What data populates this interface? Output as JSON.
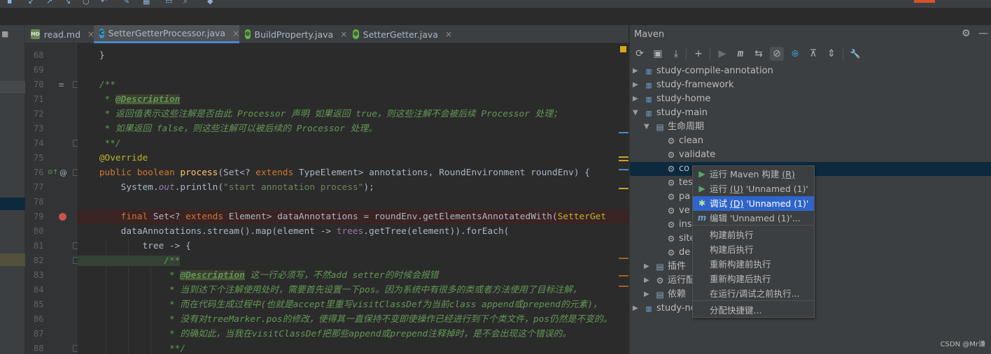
{
  "tabs": [
    {
      "label": "read.md",
      "icon": "markdown-icon",
      "close": "×"
    },
    {
      "label": "SetterGetterProcessor.java",
      "icon": "java-class-icon",
      "close": "×"
    },
    {
      "label": "BuildProperty.java",
      "icon": "java-file-icon",
      "close": "×"
    },
    {
      "label": "SetterGetter.java",
      "icon": "java-file-icon",
      "close": "×"
    }
  ],
  "editor": {
    "line_numbers": [
      "68",
      "69",
      "70",
      "71",
      "72",
      "73",
      "74",
      "75",
      "76",
      "77",
      "78",
      "79",
      "80",
      "81",
      "82",
      "83",
      "84",
      "85",
      "86",
      "87",
      "88"
    ],
    "lines": [
      [
        {
          "t": "    }",
          "c": ""
        }
      ],
      [],
      [
        {
          "t": "    /**",
          "c": "cm"
        }
      ],
      [
        {
          "t": "     * ",
          "c": "cm"
        },
        {
          "t": "@Description",
          "c": "tag"
        }
      ],
      [
        {
          "t": "     * 返回值表示这些注解是否由此 Processor 声明 如果返回 true，则这些注解不会被后续 Processor 处理；",
          "c": "cm"
        }
      ],
      [
        {
          "t": "     * 如果返回 false，则这些注解可以被后续的 Processor 处理。",
          "c": "cm"
        }
      ],
      [
        {
          "t": "     **/",
          "c": "cm"
        }
      ],
      [
        {
          "t": "    @Override",
          "c": "ann"
        }
      ],
      [
        {
          "t": "    public boolean ",
          "c": "kw"
        },
        {
          "t": "process",
          "c": "fn"
        },
        {
          "t": "(Set<? ",
          "c": ""
        },
        {
          "t": "extends ",
          "c": "kw"
        },
        {
          "t": "TypeElement> annotations, RoundEnvironment roundEnv) {",
          "c": ""
        }
      ],
      [
        {
          "t": "        System.",
          "c": ""
        },
        {
          "t": "out",
          "c": "sttc"
        },
        {
          "t": ".println(",
          "c": ""
        },
        {
          "t": "\"start annotation process\"",
          "c": "str"
        },
        {
          "t": ");",
          "c": ""
        }
      ],
      [],
      [
        {
          "t": "        final ",
          "c": "kw"
        },
        {
          "t": "Set<? ",
          "c": ""
        },
        {
          "t": "extends ",
          "c": "kw"
        },
        {
          "t": "Element> dataAnnotations = roundEnv.getElementsAnnotatedWith(",
          "c": ""
        },
        {
          "t": "SetterGet",
          "c": "ann"
        }
      ],
      [
        {
          "t": "        dataAnnotations.stream().map(element -> ",
          "c": ""
        },
        {
          "t": "trees",
          "c": "fld"
        },
        {
          "t": ".getTree(element)).forEach(",
          "c": ""
        }
      ],
      [
        {
          "t": "            tree -> {",
          "c": ""
        }
      ],
      [
        {
          "t": "                /**",
          "c": "cm"
        }
      ],
      [
        {
          "t": "                 * ",
          "c": "cm"
        },
        {
          "t": "@Description",
          "c": "tag"
        },
        {
          "t": " 这一行必须写，不然add setter的时候会报错",
          "c": "cm"
        }
      ],
      [
        {
          "t": "                 * 当到达下个注解使用处时，需要首先设置一下pos。因为系统中有很多的类或者方法使用了目标注解，",
          "c": "cm"
        }
      ],
      [
        {
          "t": "                 * 而在代码生成过程中(也就是accept里重写visitClassDef为当前class append或prepend的元素)，",
          "c": "cm"
        }
      ],
      [
        {
          "t": "                 * 没有对treeMarker.pos的修改，使得其一直保持不变即使操作已经进行到下个类文件，pos仍然是不变的。",
          "c": "cm"
        }
      ],
      [
        {
          "t": "                 * 的确如此，当我在visitClassDef把那些append或prepend注释掉时，是不会出现这个错误的。",
          "c": "cm"
        }
      ],
      [
        {
          "t": "                 **/",
          "c": "cm"
        }
      ]
    ]
  },
  "maven": {
    "title": "Maven",
    "toolbar": [
      "reload-icon",
      "add-folder-icon",
      "download-icon",
      "plus-icon",
      "run-icon",
      "maven-goal-icon",
      "toggle-offline-icon",
      "skip-tests-icon",
      "show-dependencies-icon",
      "collapse-icon",
      "expand-icon",
      "settings-wrench-icon"
    ],
    "tree": [
      {
        "label": "study-compile-annotation",
        "level": 0,
        "arrow": "▶",
        "icon": "m"
      },
      {
        "label": "study-framework",
        "level": 0,
        "arrow": "▶",
        "icon": "m"
      },
      {
        "label": "study-home",
        "level": 0,
        "arrow": "▶",
        "icon": "m"
      },
      {
        "label": "study-main",
        "level": 0,
        "arrow": "▼",
        "icon": "m"
      },
      {
        "label": "生命周期",
        "level": 1,
        "arrow": "▼",
        "icon": "folder"
      },
      {
        "label": "clean",
        "level": 2,
        "arrow": "",
        "icon": "gear"
      },
      {
        "label": "validate",
        "level": 2,
        "arrow": "",
        "icon": "gear"
      },
      {
        "label": "co",
        "level": 2,
        "arrow": "",
        "icon": "gear"
      },
      {
        "label": "tes",
        "level": 2,
        "arrow": "",
        "icon": "gear"
      },
      {
        "label": "pa",
        "level": 2,
        "arrow": "",
        "icon": "gear"
      },
      {
        "label": "ve",
        "level": 2,
        "arrow": "",
        "icon": "gear"
      },
      {
        "label": "ins",
        "level": 2,
        "arrow": "",
        "icon": "gear"
      },
      {
        "label": "site",
        "level": 2,
        "arrow": "",
        "icon": "gear"
      },
      {
        "label": "de",
        "level": 2,
        "arrow": "",
        "icon": "gear"
      },
      {
        "label": "插件",
        "level": 1,
        "arrow": "▶",
        "icon": "folder"
      },
      {
        "label": "运行配",
        "level": 1,
        "arrow": "▶",
        "icon": "gear"
      },
      {
        "label": "依赖",
        "level": 1,
        "arrow": "▶",
        "icon": "folder"
      },
      {
        "label": "study-no",
        "level": 0,
        "arrow": "▶",
        "icon": "m"
      }
    ]
  },
  "context_menu": {
    "items": [
      {
        "label": "运行 Maven 构建 ",
        "mnemonic": "(R)",
        "icon": "▶",
        "icon_name": "run-icon",
        "highlighted": false
      },
      {
        "label": "运行 ",
        "mnemonic": "(U)",
        "suffix": " 'Unnamed (1)'",
        "icon": "▶",
        "icon_name": "run-icon",
        "highlighted": false
      },
      {
        "label": "调试 ",
        "mnemonic": "(D)",
        "suffix": " 'Unnamed (1)'",
        "icon": "✱",
        "icon_name": "debug-icon",
        "highlighted": true
      },
      {
        "label": "编辑 'Unnamed (1)'...",
        "mnemonic": "",
        "icon": "m",
        "icon_name": "maven-icon",
        "highlighted": false
      },
      {
        "label": "构建前执行",
        "mnemonic": "",
        "icon": "",
        "highlighted": false
      },
      {
        "label": "构建后执行",
        "mnemonic": "",
        "icon": "",
        "highlighted": false
      },
      {
        "label": "重新构建前执行",
        "mnemonic": "",
        "icon": "",
        "highlighted": false
      },
      {
        "label": "重新构建后执行",
        "mnemonic": "",
        "icon": "",
        "highlighted": false
      },
      {
        "label": "在运行/调试之前执行...",
        "mnemonic": "",
        "icon": "",
        "highlighted": false
      },
      {
        "label": "分配快捷键...",
        "mnemonic": "",
        "icon": "",
        "highlighted": false
      }
    ]
  },
  "watermark": "CSDN @Mr谦"
}
